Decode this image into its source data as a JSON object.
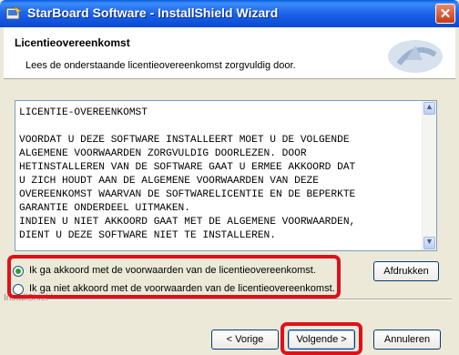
{
  "window": {
    "title": "StarBoard Software - InstallShield Wizard"
  },
  "header": {
    "title": "Licentieovereenkomst",
    "subtitle": "Lees de onderstaande licentieovereenkomst zorgvuldig door."
  },
  "license": {
    "text": "LICENTIE-OVEREENKOMST\n\nVOORDAT U DEZE SOFTWARE INSTALLEERT MOET U DE VOLGENDE\nALGEMENE VOORWAARDEN ZORGVULDIG DOORLEZEN. DOOR\nHETINSTALLEREN VAN DE SOFTWARE GAAT U ERMEE AKKOORD DAT\nU ZICH HOUDT AAN DE ALGEMENE VOORWAARDEN VAN DEZE\nOVEREENKOMST WAARVAN DE SOFTWARELICENTIE EN DE BEPERKTE\nGARANTIE ONDERDEEL UITMAKEN.\nINDIEN U NIET AKKOORD GAAT MET DE ALGEMENE VOORWAARDEN,\nDIENT U DEZE SOFTWARE NIET TE INSTALLEREN."
  },
  "options": {
    "accept": "Ik ga akkoord met de voorwaarden van de licentieovereenkomst.",
    "decline": "Ik ga niet akkoord met de voorwaarden van de licentieovereenkomst.",
    "selected": "accept"
  },
  "buttons": {
    "print": "Afdrukken",
    "back": "< Vorige",
    "next": "Volgende >",
    "cancel": "Annuleren"
  },
  "footer": {
    "brand": "InstallShield"
  },
  "colors": {
    "highlight": "#e0101a",
    "titlebar": "#0a49d4"
  }
}
